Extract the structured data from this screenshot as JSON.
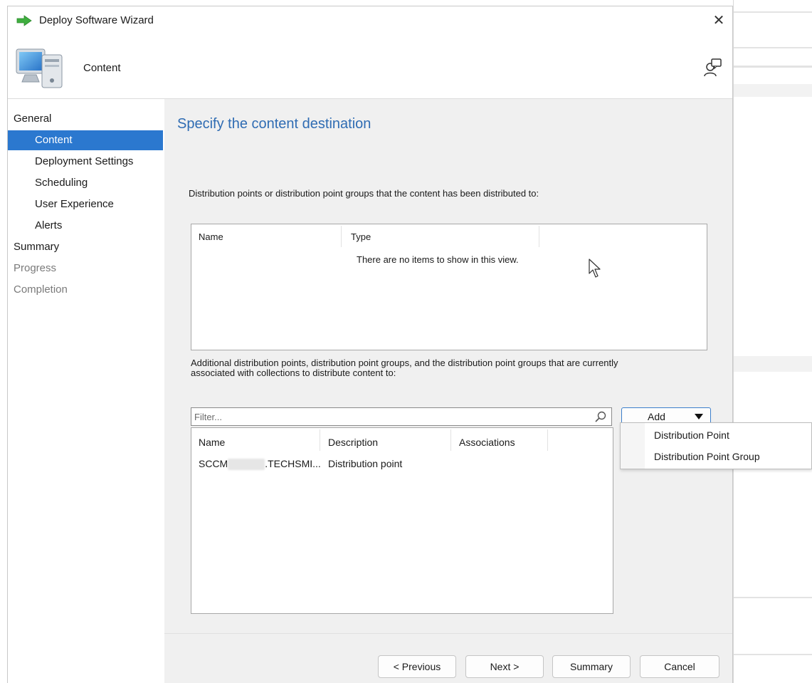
{
  "window": {
    "title": "Deploy Software Wizard",
    "close_glyph": "✕"
  },
  "header": {
    "page_name": "Content",
    "icon": "computer-icon",
    "help_icon": "help-icon"
  },
  "nav": {
    "items": [
      {
        "label": "General",
        "level": "top",
        "state": "normal"
      },
      {
        "label": "Content",
        "level": "sub",
        "state": "active"
      },
      {
        "label": "Deployment Settings",
        "level": "sub",
        "state": "normal"
      },
      {
        "label": "Scheduling",
        "level": "sub",
        "state": "normal"
      },
      {
        "label": "User Experience",
        "level": "sub",
        "state": "normal"
      },
      {
        "label": "Alerts",
        "level": "sub",
        "state": "normal"
      },
      {
        "label": "Summary",
        "level": "top",
        "state": "normal"
      },
      {
        "label": "Progress",
        "level": "top",
        "state": "disabled"
      },
      {
        "label": "Completion",
        "level": "top",
        "state": "disabled"
      }
    ]
  },
  "main": {
    "title": "Specify the content destination",
    "distributed_label": "Distribution points or distribution point groups that the content has been distributed to:",
    "distributed_list": {
      "columns": [
        "Name",
        "Type"
      ],
      "empty_message": "There are no items to show in this view."
    },
    "additional_label_line1": "Additional distribution points, distribution point groups, and the distribution point groups that are currently",
    "additional_label_line2": "associated with collections to distribute content to:",
    "filter_placeholder": "Filter...",
    "add_button_label": "Add",
    "additional_list": {
      "columns": [
        "Name",
        "Description",
        "Associations"
      ],
      "rows": [
        {
          "name_prefix": "SCCM",
          "name_suffix": ".TECHSMI...",
          "description": "Distribution point",
          "associations": ""
        }
      ]
    }
  },
  "add_menu": {
    "items": [
      "Distribution Point",
      "Distribution Point Group"
    ]
  },
  "footer": {
    "previous": "< Previous",
    "next": "Next >",
    "summary": "Summary",
    "cancel": "Cancel"
  },
  "colors": {
    "accent": "#2b78cf",
    "title_blue": "#2f6cb3",
    "panel_bg": "#f0f0f0"
  }
}
